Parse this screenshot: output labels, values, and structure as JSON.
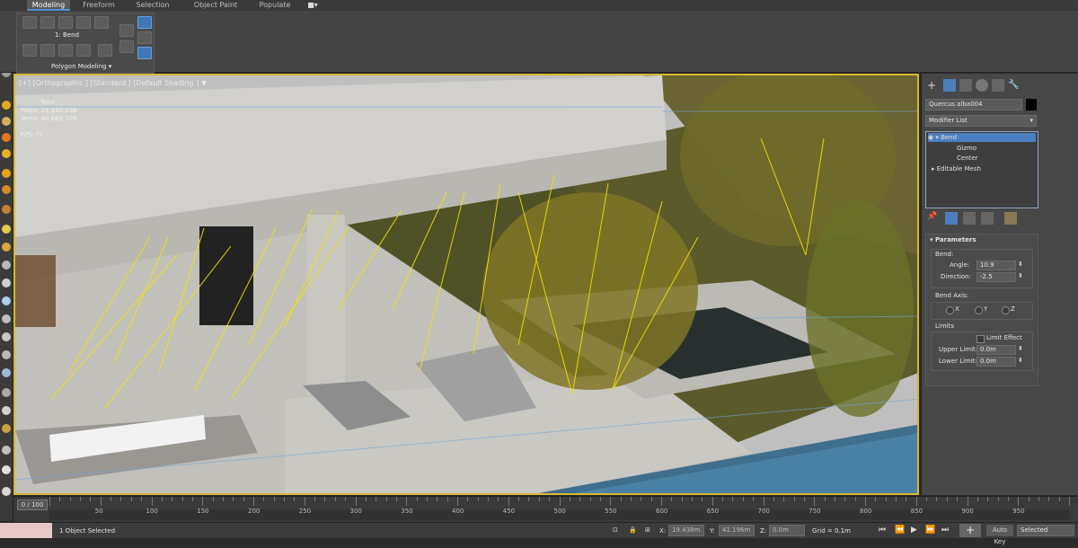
{
  "ribbon": {
    "tabs": [
      "Modeling",
      "Freeform",
      "Selection",
      "Object Paint",
      "Populate"
    ],
    "active_tab": "Modeling",
    "modifier_label": "1: Bend",
    "panel_title": "Polygon Modeling"
  },
  "viewport": {
    "label": "[+] [Orthographic ] [Standard ] [Default Shading ]",
    "stats": {
      "total_label": "Total",
      "polys_label": "Polys:",
      "polys_value": "28,650,036",
      "verts_label": "Verts:",
      "verts_value": "40,669,709",
      "fps_label": "FPS:",
      "fps_value": "?? "
    }
  },
  "command_panel": {
    "object_name": "Quercus alba004",
    "modifier_list": "Modifier List",
    "stack": [
      "Bend",
      "Gizmo",
      "Center",
      "Editable Mesh"
    ],
    "rollout_title": "Parameters",
    "bend_label": "Bend:",
    "angle_label": "Angle:",
    "angle_value": "10.9",
    "direction_label": "Direction:",
    "direction_value": "-2.5",
    "bend_axis_label": "Bend Axis:",
    "axis_options": [
      "X",
      "Y",
      "Z"
    ],
    "axis_selected": "Y",
    "limits_label": "Limits",
    "limit_effect_label": "Limit Effect",
    "upper_limit_label": "Upper Limit:",
    "upper_limit_value": "0.0m",
    "lower_limit_label": "Lower Limit:",
    "lower_limit_value": "0.0m"
  },
  "timeline": {
    "frame_indicator": "0 / 100",
    "ticks": [
      "50",
      "100",
      "150",
      "200",
      "250",
      "300",
      "350",
      "400",
      "450",
      "500",
      "550",
      "600",
      "650",
      "700",
      "750",
      "800",
      "850",
      "900",
      "950"
    ]
  },
  "status": {
    "selection": "1 Object Selected",
    "x_label": "X:",
    "x_value": "19.438m",
    "y_label": "Y:",
    "y_value": "41.196m",
    "z_label": "Z:",
    "z_value": "0.0m",
    "grid": "Grid = 0.1m",
    "auto_key": "Auto Key",
    "selected": "Selected"
  }
}
